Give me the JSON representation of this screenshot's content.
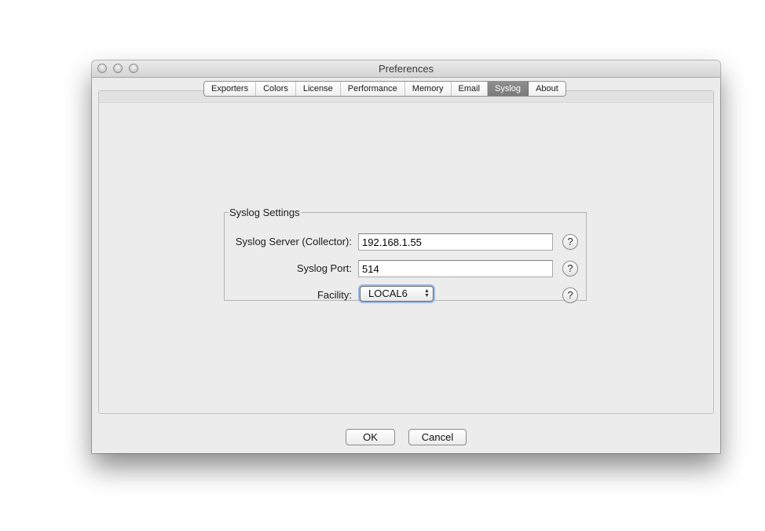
{
  "window": {
    "title": "Preferences"
  },
  "tabs": [
    {
      "label": "Exporters"
    },
    {
      "label": "Colors"
    },
    {
      "label": "License"
    },
    {
      "label": "Performance"
    },
    {
      "label": "Memory"
    },
    {
      "label": "Email"
    },
    {
      "label": "Syslog",
      "active": true
    },
    {
      "label": "About"
    }
  ],
  "syslog": {
    "group_title": "Syslog Settings",
    "server_label": "Syslog Server (Collector):",
    "server_value": "192.168.1.55",
    "port_label": "Syslog Port:",
    "port_value": "514",
    "facility_label": "Facility:",
    "facility_value": "LOCAL6",
    "help_glyph": "?"
  },
  "buttons": {
    "ok_label": "OK",
    "cancel_label": "Cancel"
  },
  "icons": {
    "help": "question-circle-icon",
    "select_arrows": "updown-chevron-icon"
  },
  "colors": {
    "active_tab": "#7f7f7f",
    "window_bg": "#ececec",
    "focus_ring": "#9ab8e8"
  }
}
